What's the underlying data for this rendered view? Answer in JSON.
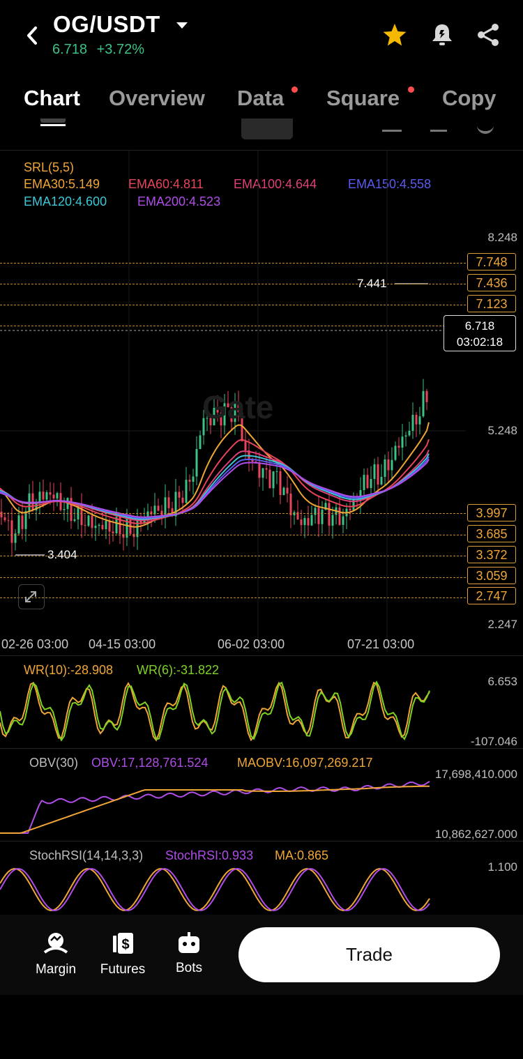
{
  "header": {
    "pair": "OG/USDT",
    "price": "6.718",
    "change": "+3.72%"
  },
  "tabs": [
    {
      "label": "Chart",
      "active": true
    },
    {
      "label": "Overview"
    },
    {
      "label": "Data",
      "dot": true
    },
    {
      "label": "Square",
      "dot": true
    },
    {
      "label": "Copy"
    }
  ],
  "indicators": {
    "srl": "SRL(5,5)",
    "ema30": "EMA30:5.149",
    "ema60": "EMA60:4.811",
    "ema100": "EMA100:4.644",
    "ema150": "EMA150:4.558",
    "ema120": "EMA120:4.600",
    "ema200": "EMA200:4.523"
  },
  "price_axis": {
    "top": "8.248",
    "mid": "5.248",
    "bottom": "2.247"
  },
  "levels": [
    "7.748",
    "7.436",
    "7.123",
    "3.997",
    "3.685",
    "3.372",
    "3.059",
    "2.747"
  ],
  "current_price": {
    "price": "6.718",
    "countdown": "03:02:18"
  },
  "high_label": "7.441",
  "low_label": "3.404",
  "x_labels": [
    "02-26 03:00",
    "04-15 03:00",
    "06-02 03:00",
    "07-21 03:00"
  ],
  "wr": {
    "label1": "WR(10):-28.908",
    "label2": "WR(6):-31.822",
    "max": "6.653",
    "min": "-107.046"
  },
  "obv": {
    "title": "OBV(30)",
    "obv": "OBV:17,128,761.524",
    "maobv": "MAOBV:16,097,269.217",
    "max": "17,698,410.000",
    "min": "10,862,627.000"
  },
  "stoch": {
    "title": "StochRSI(14,14,3,3)",
    "value": "StochRSI:0.933",
    "ma": "MA:0.865",
    "max": "1.100"
  },
  "bottom_nav": {
    "margin": "Margin",
    "futures": "Futures",
    "bots": "Bots",
    "trade": "Trade"
  },
  "colors": {
    "up": "#3cc285",
    "down": "#e8455a",
    "ema30": "#f0a637",
    "ema60": "#e8455a",
    "ema100": "#e0407a",
    "ema150": "#5b5bf0",
    "ema120": "#3ec6d6",
    "ema200": "#b04de8"
  }
}
